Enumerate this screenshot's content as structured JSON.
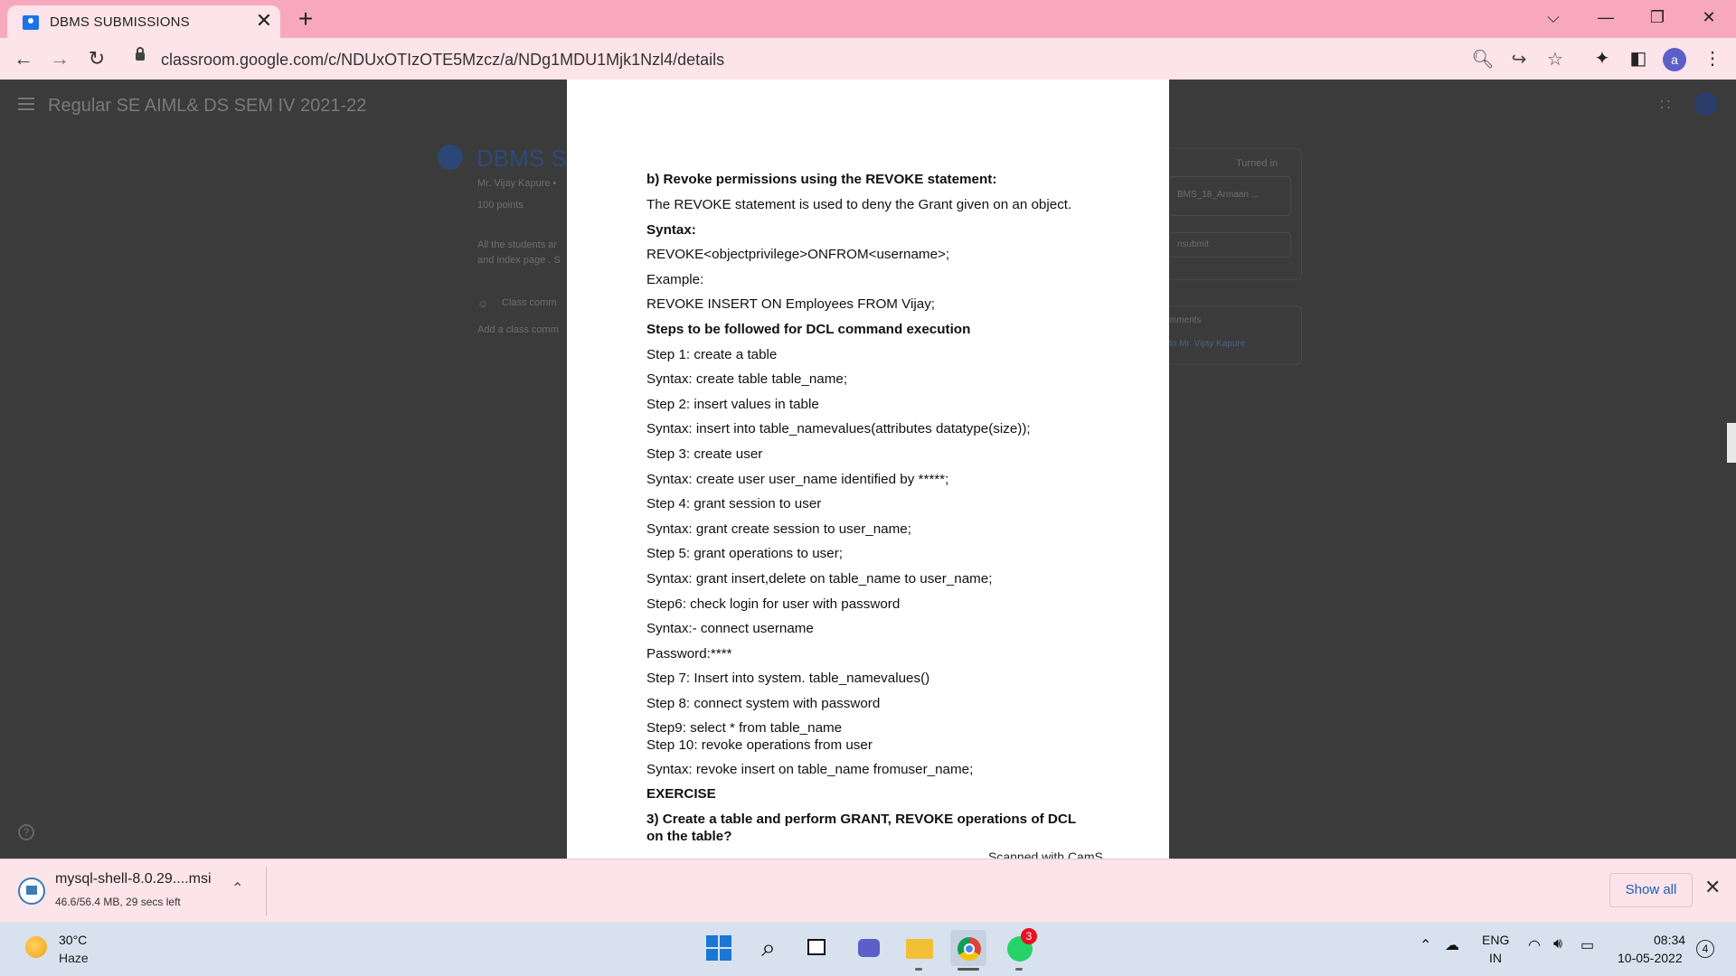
{
  "browser": {
    "tab_title": "DBMS SUBMISSIONS",
    "tab_close": "✕",
    "new_tab": "+",
    "url": "classroom.google.com/c/NDUxOTIzOTE5Mzcz/a/NDg1MDU1Mjk1Nzl4/details",
    "profile_initial": "a",
    "window_controls": {
      "tab_search": "⌵",
      "minimize": "—",
      "restore": "❐",
      "close": "✕"
    },
    "nav_icons": {
      "back": "←",
      "forward": "→",
      "reload": "↻"
    }
  },
  "classroom": {
    "class_name": "Regular SE AIML& DS SEM IV 2021-22",
    "assignment_title": "DBMS SU",
    "teacher": "Mr. Vijay Kapure •",
    "points": "100 points",
    "instructions_1": "All the students ar",
    "instructions_2": "and index page . S",
    "class_comments": "Class comm",
    "add_comment": "Add a class comm",
    "turned_in": "Turned in",
    "attachment": "BMS_18_Armaan ...",
    "unsubmit": "nsubmit",
    "private_comments": "mments",
    "private_comment_to": "to Mr. Vijay Kapure"
  },
  "document": {
    "lines": [
      {
        "text": "b) Revoke permissions using the REVOKE statement:",
        "bold": true
      },
      {
        "text": "The REVOKE statement is used to deny the Grant given on an object.",
        "bold": false
      },
      {
        "text": "Syntax:",
        "bold": true
      },
      {
        "text": "REVOKE<objectprivilege>ONFROM<username>;",
        "bold": false
      },
      {
        "text": "Example:",
        "bold": false
      },
      {
        "text": "REVOKE INSERT ON Employees FROM Vijay;",
        "bold": false
      },
      {
        "text": "Steps to be followed for DCL command execution",
        "bold": true
      },
      {
        "text": "Step 1: create a table",
        "bold": false
      },
      {
        "text": "Syntax: create table table_name;",
        "bold": false
      },
      {
        "text": "Step 2: insert values in table",
        "bold": false
      },
      {
        "text": "Syntax: insert into table_namevalues(attributes datatype(size));",
        "bold": false
      },
      {
        "text": "Step 3: create user",
        "bold": false
      },
      {
        "text": "Syntax: create user user_name identified by *****;",
        "bold": false
      },
      {
        "text": "Step 4: grant session to user",
        "bold": false
      },
      {
        "text": "Syntax: grant create session to user_name;",
        "bold": false
      },
      {
        "text": "Step 5: grant operations to user;",
        "bold": false
      },
      {
        "text": "Syntax: grant insert,delete on table_name to user_name;",
        "bold": false
      },
      {
        "text": "Step6: check login for user with password",
        "bold": false
      },
      {
        "text": "Syntax:- connect username",
        "bold": false
      },
      {
        "text": "Password:****",
        "bold": false
      },
      {
        "text": "Step 7: Insert into system. table_namevalues()",
        "bold": false
      },
      {
        "text": "Step 8: connect system with password",
        "bold": false
      },
      {
        "text": "Step9: select * from table_name",
        "bold": false
      },
      {
        "text": "Step 10: revoke operations from user",
        "bold": false
      },
      {
        "text": "Syntax: revoke insert on table_name fromuser_name;",
        "bold": false
      },
      {
        "text": "EXERCISE",
        "bold": true
      },
      {
        "text": "3) Create a table and perform GRANT, REVOKE operations of DCL",
        "bold": true
      },
      {
        "text": "on the table?",
        "bold": true
      }
    ],
    "footer_partial": "Scanned with CamS"
  },
  "download": {
    "file_name": "mysql-shell-8.0.29....msi",
    "status": "46.6/56.4 MB, 29 secs left",
    "show_all": "Show all"
  },
  "taskbar": {
    "temperature": "30°C",
    "weather": "Haze",
    "whatsapp_badge": "3",
    "lang_line1": "ENG",
    "lang_line2": "IN",
    "time": "08:34",
    "date": "10-05-2022",
    "notifications": "4"
  },
  "colors": {
    "tab_strip": "#f7a8bd",
    "toolbar": "#fde3ea",
    "page_dim": "#3b3b3b",
    "document": "#ffffff",
    "taskbar": "#d7e2ee"
  }
}
